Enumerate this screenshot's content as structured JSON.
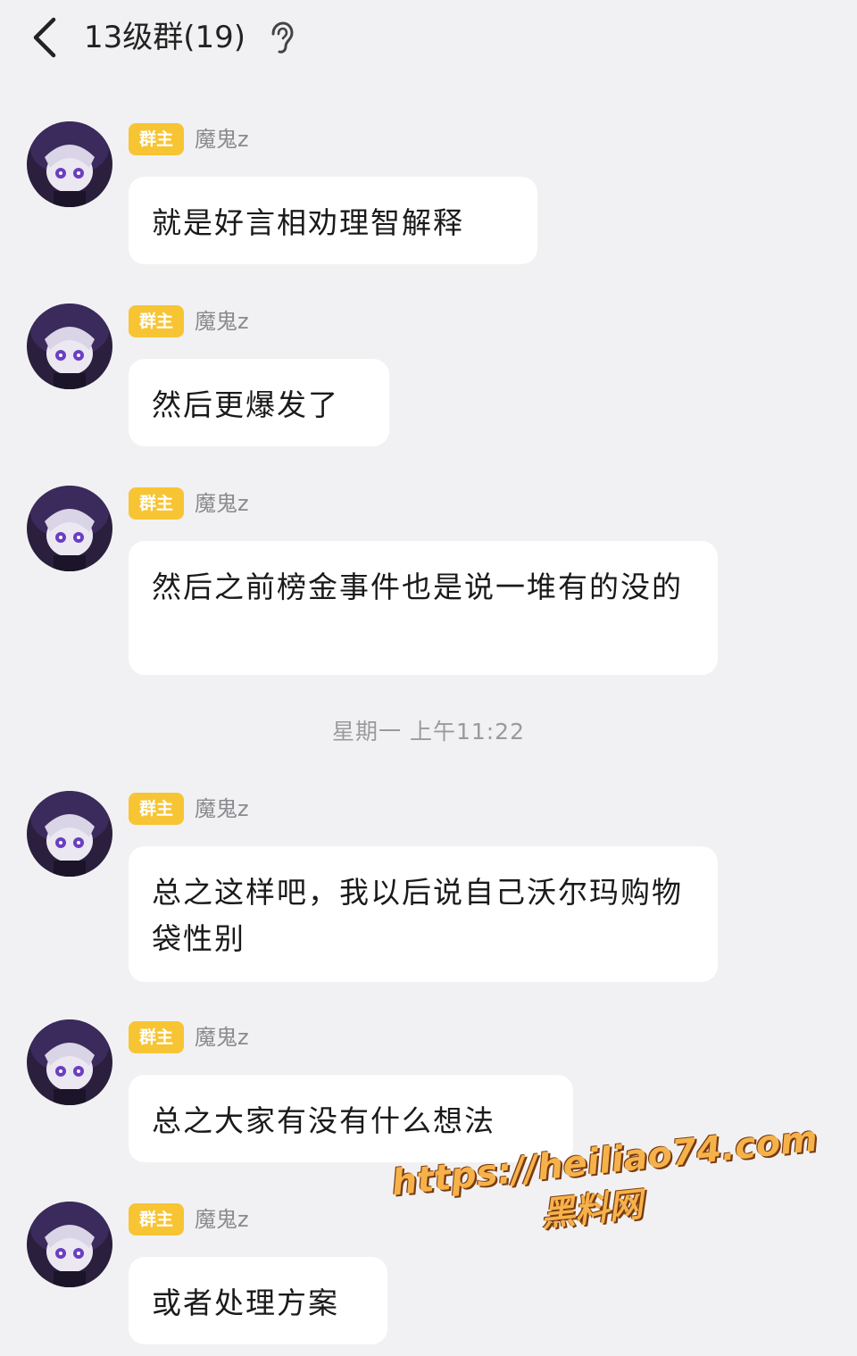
{
  "header": {
    "title": "13级群(19)",
    "back_icon": "chevron-left-icon",
    "ear_icon": "ear-icon"
  },
  "messages": [
    {
      "badge": "群主",
      "sender": "魔鬼z",
      "text": "就是好言相劝理智解释"
    },
    {
      "badge": "群主",
      "sender": "魔鬼z",
      "text": "然后更爆发了"
    },
    {
      "badge": "群主",
      "sender": "魔鬼z",
      "text": "然后之前榜金事件也是说一堆有的没的"
    },
    {
      "badge": "群主",
      "sender": "魔鬼z",
      "text": "总之这样吧，我以后说自己沃尔玛购物袋性别"
    },
    {
      "badge": "群主",
      "sender": "魔鬼z",
      "text": "总之大家有没有什么想法"
    },
    {
      "badge": "群主",
      "sender": "魔鬼z",
      "text": "或者处理方案"
    }
  ],
  "timestamp": "星期一 上午11:22",
  "watermark": {
    "url": "https://heiliao74.com",
    "name": "黑料网"
  },
  "colors": {
    "badge": "#f7c434",
    "background": "#f1f1f3",
    "bubble": "#ffffff",
    "watermark": "#f6b24a"
  }
}
